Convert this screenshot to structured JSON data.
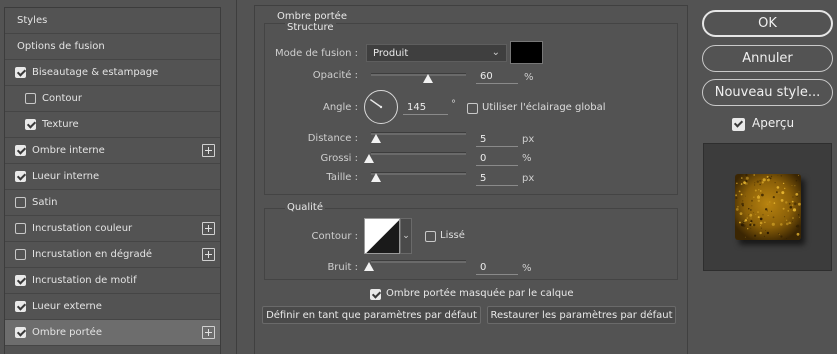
{
  "left_list": {
    "items": [
      {
        "label": "Styles",
        "checkbox": null,
        "indent": false,
        "plus": false,
        "selected": false
      },
      {
        "label": "Options de fusion",
        "checkbox": null,
        "indent": false,
        "plus": false,
        "selected": false
      },
      {
        "label": "Biseautage & estampage",
        "checkbox": true,
        "indent": false,
        "plus": false,
        "selected": false
      },
      {
        "label": "Contour",
        "checkbox": false,
        "indent": true,
        "plus": false,
        "selected": false
      },
      {
        "label": "Texture",
        "checkbox": true,
        "indent": true,
        "plus": false,
        "selected": false
      },
      {
        "label": "Ombre interne",
        "checkbox": true,
        "indent": false,
        "plus": true,
        "selected": false
      },
      {
        "label": "Lueur interne",
        "checkbox": true,
        "indent": false,
        "plus": false,
        "selected": false
      },
      {
        "label": "Satin",
        "checkbox": false,
        "indent": false,
        "plus": false,
        "selected": false
      },
      {
        "label": "Incrustation couleur",
        "checkbox": false,
        "indent": false,
        "plus": true,
        "selected": false
      },
      {
        "label": "Incrustation en dégradé",
        "checkbox": false,
        "indent": false,
        "plus": true,
        "selected": false
      },
      {
        "label": "Incrustation de motif",
        "checkbox": true,
        "indent": false,
        "plus": false,
        "selected": false
      },
      {
        "label": "Lueur externe",
        "checkbox": true,
        "indent": false,
        "plus": false,
        "selected": false
      },
      {
        "label": "Ombre portée",
        "checkbox": true,
        "indent": false,
        "plus": true,
        "selected": true
      }
    ]
  },
  "panel": {
    "title": "Ombre portée",
    "structure": {
      "title": "Structure",
      "blend_mode_label": "Mode de fusion :",
      "blend_mode_value": "Produit",
      "color_swatch": "#000000",
      "opacity_label": "Opacité :",
      "opacity_value": "60",
      "opacity_unit": "%",
      "opacity_fraction": 0.6,
      "angle_label": "Angle :",
      "angle_value": "145",
      "angle_unit": "°",
      "angle_degrees": 145,
      "global_light_label": "Utiliser l'éclairage global",
      "global_light_checked": false,
      "distance_label": "Distance :",
      "distance_value": "5",
      "distance_unit": "px",
      "spread_label": "Grossi :",
      "spread_value": "0",
      "spread_unit": "%",
      "size_label": "Taille :",
      "size_value": "5",
      "size_unit": "px"
    },
    "quality": {
      "title": "Qualité",
      "contour_label": "Contour :",
      "antialias_label": "Lissé",
      "antialias_checked": false,
      "noise_label": "Bruit :",
      "noise_value": "0",
      "noise_unit": "%"
    },
    "knockout_label": "Ombre portée masquée par le calque",
    "knockout_checked": true,
    "set_default_label": "Définir en tant que paramètres par défaut",
    "reset_default_label": "Restaurer les paramètres par défaut"
  },
  "right": {
    "ok_label": "OK",
    "cancel_label": "Annuler",
    "new_style_label": "Nouveau style...",
    "preview_label": "Aperçu",
    "preview_checked": true
  },
  "colors": {
    "background": "#535353",
    "selected_row": "#6d6d6d",
    "preview_bg": "#3c3c3c",
    "preview_tile": "#8a5f08"
  }
}
